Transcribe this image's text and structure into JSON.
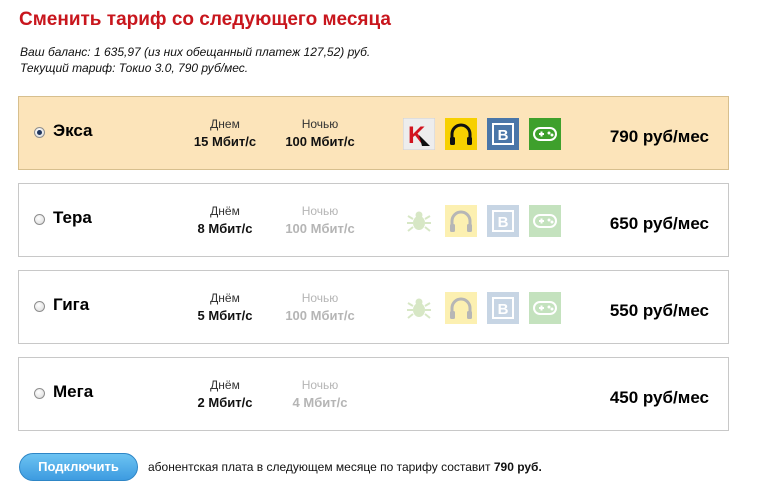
{
  "page": {
    "title": "Сменить тариф со следующего месяца",
    "balance_line": "Ваш баланс: 1 635,97 (из них обещанный платеж 127,52) руб.",
    "tariff_line": "Текущий тариф: Токио 3.0, 790 руб/мес."
  },
  "tariffs": [
    {
      "name": "Экса",
      "day_label": "Днем",
      "day_speed": "15 Мбит/с",
      "night_label": "Ночью",
      "night_speed": "100 Мбит/с",
      "price": "790 руб/мес",
      "selected": true
    },
    {
      "name": "Тера",
      "day_label": "Днём",
      "day_speed": "8 Мбит/с",
      "night_label": "Ночью",
      "night_speed": "100 Мбит/с",
      "price": "650 руб/мес",
      "selected": false
    },
    {
      "name": "Гига",
      "day_label": "Днём",
      "day_speed": "5 Мбит/с",
      "night_label": "Ночью",
      "night_speed": "100 Мбит/с",
      "price": "550 руб/мес",
      "selected": false
    },
    {
      "name": "Мега",
      "day_label": "Днём",
      "day_speed": "2 Мбит/с",
      "night_label": "Ночью",
      "night_speed": "4 Мбит/с",
      "price": "450 руб/мес",
      "selected": false
    }
  ],
  "icons": {
    "antivirus_letter": "K",
    "vk_letter": "B",
    "colors": {
      "kaspersky_red": "#d2141f",
      "music_yellow": "#f7d000",
      "vk_blue": "#4a76a8",
      "games_green": "#3ea02c",
      "antivirus_green": "#7cb342"
    }
  },
  "colors": {
    "title_red": "#c8161d",
    "selected_bg": "#fce4ba",
    "button_blue": "#3d9be0"
  },
  "footer": {
    "connect_button": "Подключить",
    "note_text": "абонентская плата в следующем месяце по тарифу составит ",
    "note_amount": "790 руб."
  }
}
